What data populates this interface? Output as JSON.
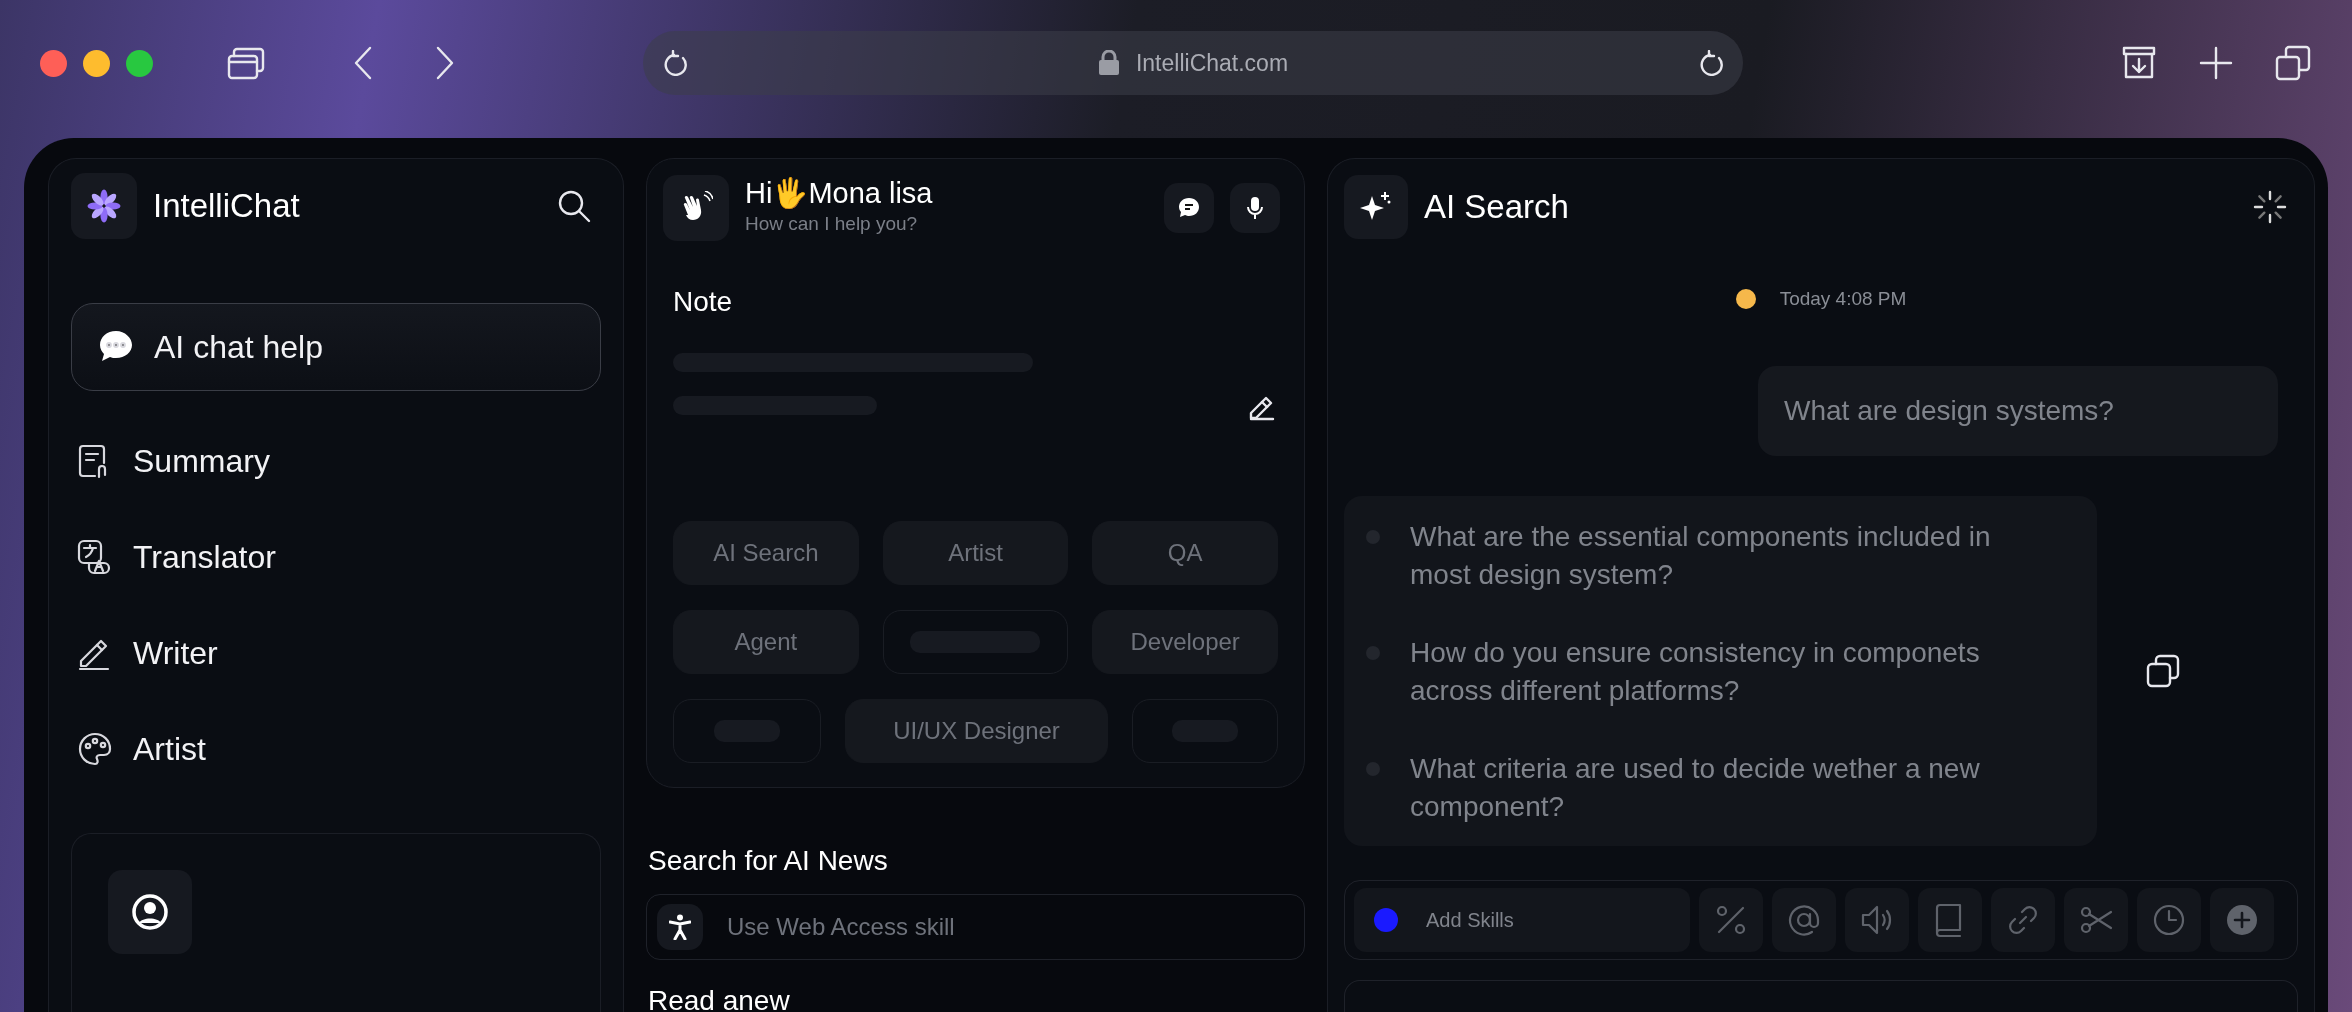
{
  "browser": {
    "url": "IntelliChat.com"
  },
  "sidebar": {
    "brand": "IntelliChat",
    "items": [
      {
        "label": "AI chat help",
        "selected": true
      },
      {
        "label": "Summary",
        "selected": false
      },
      {
        "label": "Translator",
        "selected": false
      },
      {
        "label": "Writer",
        "selected": false
      },
      {
        "label": "Artist",
        "selected": false
      }
    ]
  },
  "assistant": {
    "greeting": "Hi🖐Mona lisa",
    "subtitle": "How can I help you?",
    "note_title": "Note",
    "chip_rows": [
      [
        {
          "kind": "text",
          "label": "AI Search"
        },
        {
          "kind": "text",
          "label": "Artist"
        },
        {
          "kind": "text",
          "label": "QA"
        }
      ],
      [
        {
          "kind": "text",
          "label": "Agent"
        },
        {
          "kind": "skeleton"
        },
        {
          "kind": "text",
          "label": "Developer"
        }
      ],
      [
        {
          "kind": "skeleton"
        },
        {
          "kind": "text",
          "label": "UI/UX Designer"
        },
        {
          "kind": "skeleton"
        }
      ]
    ]
  },
  "news": {
    "title": "Search for AI News",
    "placeholder": "Use Web Access skill"
  },
  "next_section": {
    "title": "Read anew"
  },
  "chat": {
    "title": "AI Search",
    "timestamp": "Today 4:08 PM",
    "status_dot": {
      "color": "#f6b84b"
    },
    "user_message": "What are design systems?",
    "suggestions": [
      "What are the essential components included in most design system?",
      "How do you ensure consistency in componets across different platforms?",
      "What criteria are used to decide wether a new component?"
    ],
    "skills": {
      "placeholder": "Add Skills",
      "color": "#1a1aff"
    }
  }
}
